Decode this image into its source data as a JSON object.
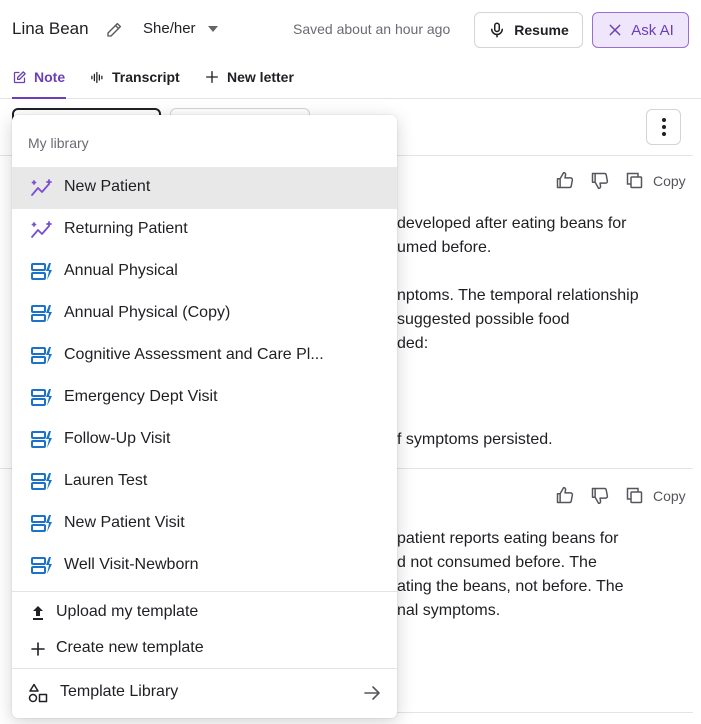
{
  "header": {
    "patient_name": "Lina Bean",
    "pronouns": "She/her",
    "saved_status": "Saved about an hour ago",
    "resume_label": "Resume",
    "ask_ai_label": "Ask AI",
    "accent_color": "#6b3fb8"
  },
  "tabs": [
    {
      "label": "Note",
      "icon": "note-edit-icon",
      "active": true
    },
    {
      "label": "Transcript",
      "icon": "waveform-icon",
      "active": false
    },
    {
      "label": "New letter",
      "icon": "plus-icon",
      "active": false
    }
  ],
  "sections": [
    {
      "copy_label": "Copy",
      "lines": [
        "developed after eating beans for",
        "umed before.",
        "",
        "nptoms. The temporal relationship",
        " suggested possible food",
        "ded:",
        "",
        "",
        "f symptoms persisted."
      ]
    },
    {
      "copy_label": "Copy",
      "lines": [
        "patient reports eating beans for",
        "d not consumed before. The",
        "ating the beans, not before. The",
        "nal symptoms."
      ]
    }
  ],
  "dropdown": {
    "header": "My library",
    "items": [
      {
        "label": "New Patient",
        "icon": "sparkle-chart-icon",
        "selected": true
      },
      {
        "label": "Returning Patient",
        "icon": "sparkle-chart-icon",
        "selected": false
      },
      {
        "label": "Annual Physical",
        "icon": "template-bolt-icon",
        "selected": false
      },
      {
        "label": "Annual Physical (Copy)",
        "icon": "template-bolt-icon",
        "selected": false
      },
      {
        "label": "Cognitive Assessment and Care Pl...",
        "icon": "template-bolt-icon",
        "selected": false
      },
      {
        "label": "Emergency Dept Visit",
        "icon": "template-bolt-icon",
        "selected": false
      },
      {
        "label": "Follow-Up Visit",
        "icon": "template-bolt-icon",
        "selected": false
      },
      {
        "label": "Lauren Test",
        "icon": "template-bolt-icon",
        "selected": false
      },
      {
        "label": "New Patient Visit",
        "icon": "template-bolt-icon",
        "selected": false
      },
      {
        "label": "Well Visit-Newborn",
        "icon": "template-bolt-icon",
        "selected": false
      }
    ],
    "upload_label": "Upload my template",
    "create_label": "Create new template",
    "library_label": "Template Library"
  }
}
